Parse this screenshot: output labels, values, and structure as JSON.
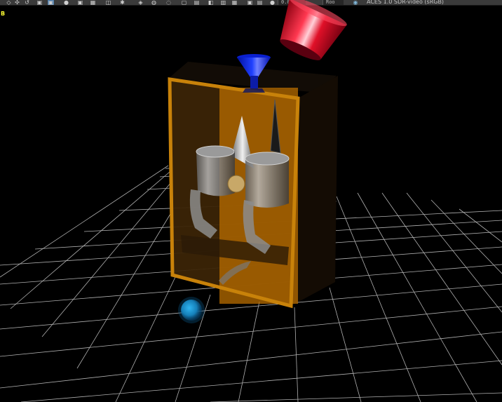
{
  "toolbar": {
    "frame_field": "0.00",
    "view_field": "Roo",
    "color_space": "ACES 1.0 SDR-video (sRGB)",
    "icons": [
      "select-icon",
      "move-icon",
      "cube-icon",
      "cube-active-icon",
      "sphere-icon",
      "rotate-icon",
      "scale-icon",
      "grid-icon",
      "camera-icon",
      "light-icon",
      "render-icon",
      "texture-icon",
      "camera-view-icon",
      "isolate-icon",
      "wireframe-icon",
      "shaded-icon",
      "bounding-box-icon",
      "display-icon",
      "screenshot-icon",
      "hud-icon",
      "info-icon"
    ]
  },
  "viewport": {
    "corner_label": "B",
    "colors": {
      "background": "#000000",
      "grid": "#d0d0d0",
      "box_frame": "#c8820a",
      "cup": "#d8102a",
      "funnel": "#1530ff",
      "ball": "#1a90d0"
    }
  }
}
